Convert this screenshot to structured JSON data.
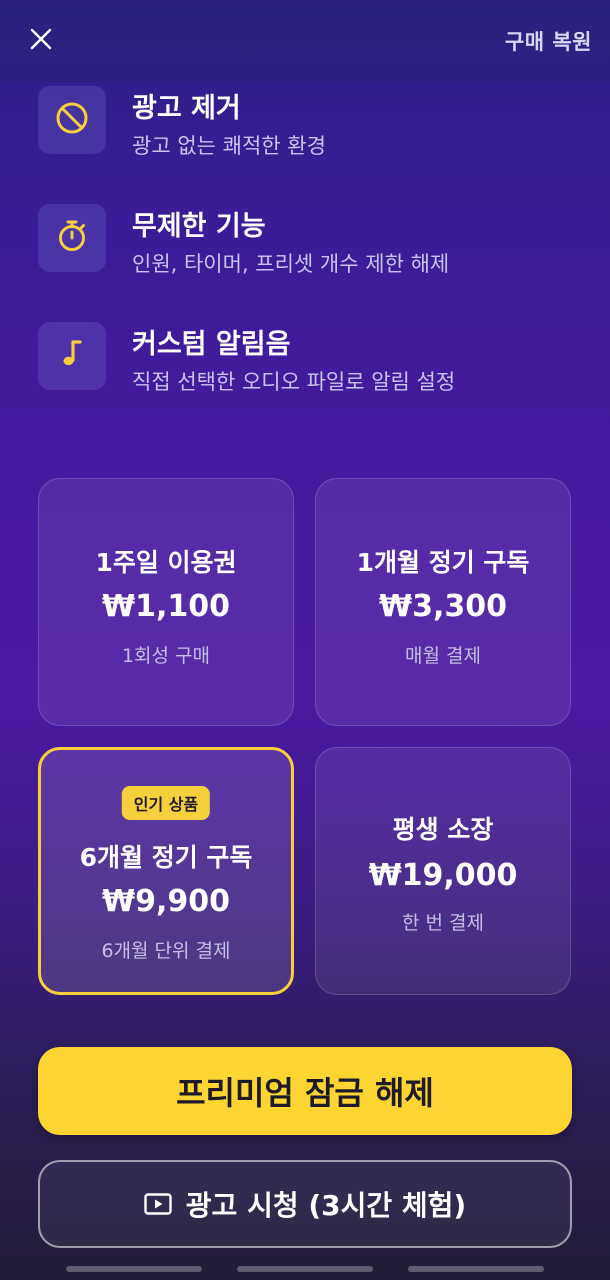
{
  "header": {
    "close_icon": "close-icon",
    "restore_label": "구매 복원"
  },
  "features": [
    {
      "icon": "no-ads-icon",
      "title": "광고 제거",
      "desc": "광고 없는 쾌적한 환경"
    },
    {
      "icon": "stopwatch-icon",
      "title": "무제한 기능",
      "desc": "인원, 타이머, 프리셋 개수 제한 해제"
    },
    {
      "icon": "music-note-icon",
      "title": "커스텀 알림음",
      "desc": "직접 선택한 오디오 파일로 알림 설정"
    }
  ],
  "plans": [
    {
      "name": "1주일 이용권",
      "price": "₩1,100",
      "note": "1회성 구매",
      "selected": false
    },
    {
      "name": "1개월 정기 구독",
      "price": "₩3,300",
      "note": "매월 결제",
      "selected": false
    },
    {
      "badge": "인기 상품",
      "name": "6개월 정기 구독",
      "price": "₩9,900",
      "note": "6개월 단위 결제",
      "selected": true
    },
    {
      "name": "평생 소장",
      "price": "₩19,000",
      "note": "한 번 결제",
      "selected": false
    }
  ],
  "cta": {
    "label": "프리미엄 잠금 해제"
  },
  "ad_button": {
    "icon": "play-icon",
    "label": "광고 시청 (3시간 체험)"
  },
  "colors": {
    "accent": "#fcd532",
    "icon_yellow": "#f5cf3c",
    "muted_text": "#c9c4ef"
  }
}
